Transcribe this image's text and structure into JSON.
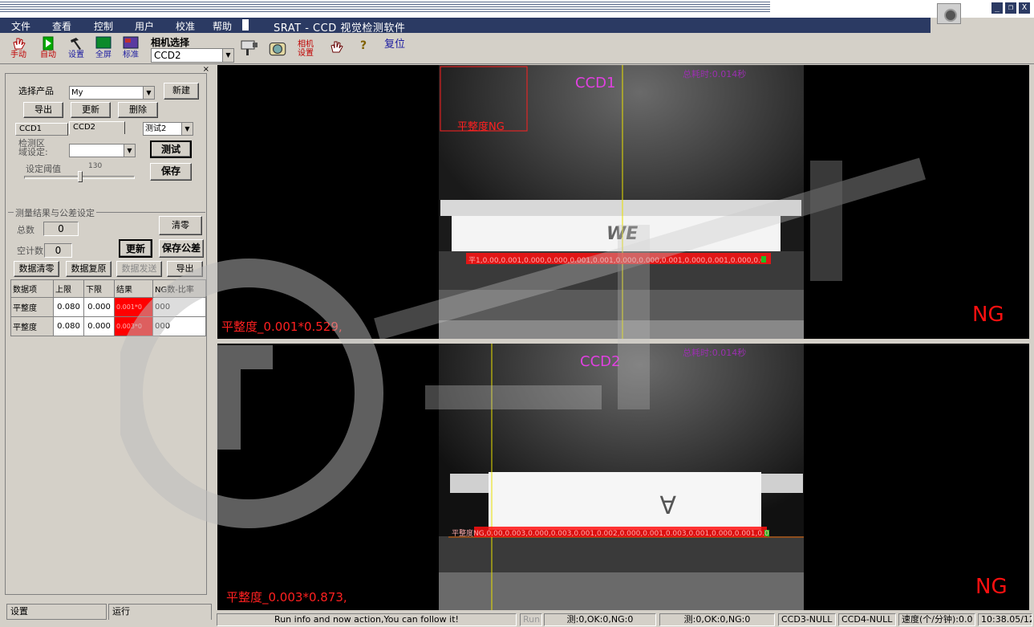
{
  "menu": {
    "items": [
      "文件",
      "查看",
      "控制",
      "用户",
      "校准",
      "帮助"
    ],
    "app_title": "SRAT - CCD 视觉检测软件"
  },
  "window": {
    "minimize": "_",
    "restore": "❐",
    "close": "X"
  },
  "toolbar": {
    "manual": "手动",
    "auto": "自动",
    "settings": "设置",
    "fullscreen": "全屏",
    "standard": "标准",
    "camera_select_label": "相机选择",
    "camera_selected": "CCD2",
    "camera_settings": "相机\n设置",
    "reset": "复位"
  },
  "left": {
    "select_product_label": "选择产品",
    "product_value": "My",
    "new_btn": "新建",
    "export_btn": "导出",
    "update_btn": "更新",
    "delete_btn": "删除",
    "tab_ccd1": "CCD1",
    "tab_ccd2": "CCD2",
    "test_combo": "测试2",
    "region_label": "检测区\n域设定:",
    "region_value": "",
    "test_btn": "测试",
    "save_btn": "保存",
    "threshold_label": "设定阈值",
    "threshold_value": "130",
    "group_title": "测量结果与公差设定",
    "total_label": "总数",
    "total_value": "0",
    "clear_btn": "清零",
    "empty_count_label": "空计数",
    "empty_count_value": "0",
    "refresh_btn": "更新",
    "save_tol_btn": "保存公差",
    "data_clear_btn": "数据清零",
    "data_restore_btn": "数据复原",
    "data_send_btn": "数据发送",
    "export2_btn": "导出",
    "table": {
      "headers": [
        "数据项",
        "上限",
        "下限",
        "结果",
        "NG数-比率"
      ],
      "rows": [
        [
          "平整度",
          "0.080",
          "0.000",
          "0.001*0",
          "000"
        ],
        [
          "平整度",
          "0.080",
          "0.000",
          "0.003*0",
          "000"
        ]
      ]
    },
    "bottom_tab_settings": "设置",
    "bottom_tab_run": "运行"
  },
  "views": {
    "ccd1": {
      "label": "CCD1",
      "timing": "总耗时:0.014秒",
      "roi_label": "平整度NG",
      "result": "平整度_0.001*0.529,",
      "status": "NG",
      "overlay": "平1,0.00,0.001,0.000,0.000,0.001,0.001,0.000,0.000,0.001,0.000,0.001,0.000,0.001,0.001"
    },
    "ccd2": {
      "label": "CCD2",
      "timing": "总耗时:0.014秒",
      "result": "平整度_0.003*0.873,",
      "status": "NG",
      "overlay": "平整度NG,0.00,0.003,0.000,0.003,0.001,0.002,0.000,0.001,0.003,0.001,0.000,0.001,0.002,0.000,0.001,0.003,0.1,0.000,0.03,1,4"
    }
  },
  "statusbar": {
    "info": "Run info and now action,You can follow it!",
    "run": "Run",
    "ccd1_count": "测:0,OK:0,NG:0",
    "ccd2_count": "测:0,OK:0,NG:0",
    "ccd3": "CCD3-NULL",
    "ccd4": "CCD4-NULL",
    "speed": "速度(个/分钟):0.0",
    "time": "10:38.05/12"
  },
  "colors": {
    "menu_bg": "#2b3a63",
    "ng_red": "#ff1010",
    "ccd_label": "#e040e0",
    "cross_line": "#e8e000"
  }
}
